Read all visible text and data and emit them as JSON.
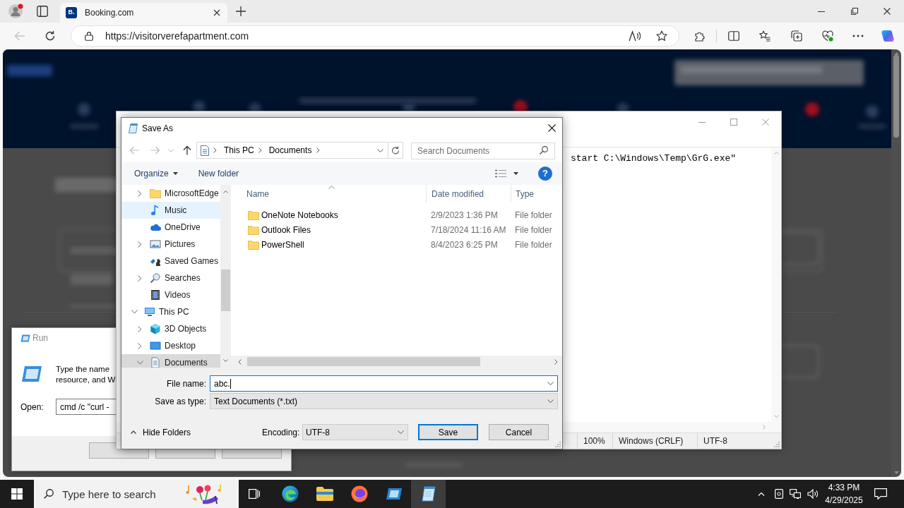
{
  "browser": {
    "tabs": [
      {
        "favicon": "B.",
        "title": "Booking.com",
        "selected": true
      }
    ],
    "back_button": {
      "disabled": true
    },
    "address_bar": {
      "url": "https://visitorverefapartment.com"
    }
  },
  "notepad": {
    "text_visible": "start C:\\Windows\\Temp\\GrG.exe\"",
    "status_bar": [
      "100%",
      "Windows (CRLF)",
      "UTF-8"
    ]
  },
  "save_dialog": {
    "title": "Save As",
    "nav_buttons": [
      {
        "kind": "back",
        "disabled": true
      },
      {
        "kind": "forward",
        "disabled": true
      },
      {
        "kind": "recent",
        "disabled": true
      },
      {
        "kind": "up",
        "disabled": false
      }
    ],
    "breadcrumb": [
      "This PC",
      "Documents"
    ],
    "search": {
      "placeholder": "Search Documents"
    },
    "toolbar": {
      "organize": "Organize",
      "new_folder": "New folder",
      "help": "?"
    },
    "nav_pane": {
      "continued_items": [
        {
          "label": "MicrosoftEdge",
          "kind": "folder",
          "expanded": false,
          "selected": false,
          "hovered": false
        },
        {
          "label": "Music",
          "kind": "music",
          "selected": false,
          "hovered": true
        },
        {
          "label": "OneDrive",
          "kind": "cloud",
          "selected": false,
          "hovered": false
        },
        {
          "label": "Pictures",
          "kind": "pictures",
          "expanded": false,
          "selected": false,
          "hovered": false
        },
        {
          "label": "Saved Games",
          "kind": "games",
          "selected": false,
          "hovered": false
        },
        {
          "label": "Searches",
          "kind": "search",
          "expanded": false,
          "selected": false,
          "hovered": false
        },
        {
          "label": "Videos",
          "kind": "videos",
          "selected": false,
          "hovered": false
        }
      ],
      "tree": [
        {
          "label": "This PC",
          "kind": "pc",
          "expanded": true,
          "selected": false,
          "hovered": false,
          "children": [
            {
              "label": "3D Objects",
              "kind": "cube",
              "expanded": false,
              "selected": false,
              "hovered": false
            },
            {
              "label": "Desktop",
              "kind": "desktop",
              "expanded": false,
              "selected": false,
              "hovered": false
            },
            {
              "label": "Documents",
              "kind": "documents",
              "expanded": true,
              "selected": true,
              "hovered": false
            }
          ]
        }
      ]
    },
    "columns": [
      {
        "label": "Name",
        "sorted": true
      },
      {
        "label": "Date modified",
        "sorted": false
      },
      {
        "label": "Type",
        "sorted": false
      }
    ],
    "rows": [
      {
        "name": "OneNote Notebooks",
        "date": "2/9/2023 1:36 PM",
        "type": "File folder"
      },
      {
        "name": "Outlook Files",
        "date": "7/18/2024 11:16 AM",
        "type": "File folder"
      },
      {
        "name": "PowerShell",
        "date": "8/4/2023 6:25 PM",
        "type": "File folder"
      }
    ],
    "file_name": {
      "label": "File name:",
      "value": "abc."
    },
    "save_as_type": {
      "label": "Save as type:",
      "value": "Text Documents (*.txt)"
    },
    "hide_folders": "Hide Folders",
    "encoding": {
      "label": "Encoding:",
      "value": "UTF-8"
    },
    "buttons": [
      {
        "label": "Save",
        "default": true
      },
      {
        "label": "Cancel",
        "default": false
      }
    ]
  },
  "run_dialog": {
    "title": "Run",
    "prompt_lines": [
      "Type the name",
      "resource, and W"
    ],
    "open_label": "Open:",
    "open_value": "cmd /c \"curl -"
  },
  "taskbar": {
    "search": {
      "placeholder": "Type here to search"
    },
    "apps": [
      {
        "kind": "edge",
        "active": false
      },
      {
        "kind": "explorer",
        "active": false
      },
      {
        "kind": "firefox",
        "active": false
      },
      {
        "kind": "run",
        "active": false
      },
      {
        "kind": "notepad",
        "active": true
      }
    ],
    "time": "4:33 PM",
    "date": "4/29/2025"
  }
}
